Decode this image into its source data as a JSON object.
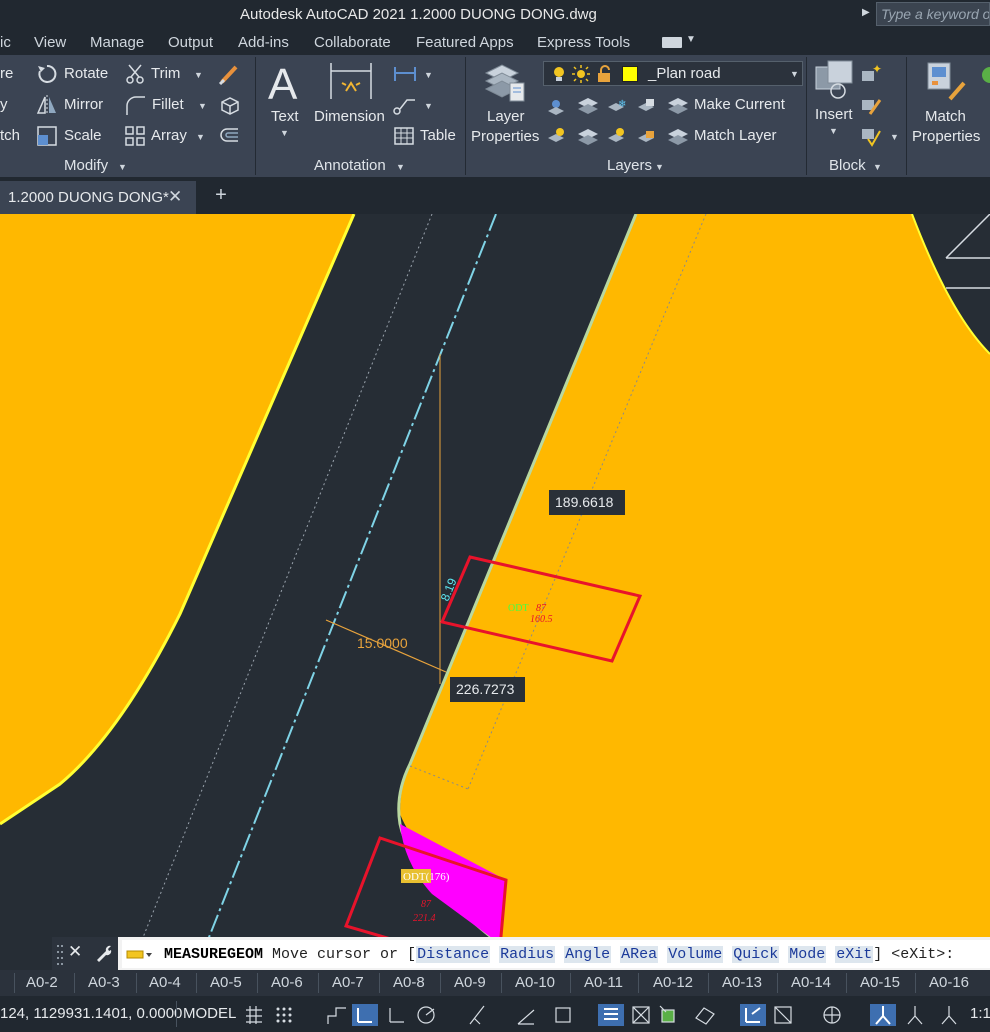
{
  "window": {
    "title": "Autodesk AutoCAD 2021    1.2000 DUONG DONG.dwg",
    "search_placeholder": "Type a keyword or"
  },
  "menu": {
    "tabs": [
      "ic",
      "View",
      "Manage",
      "Output",
      "Add-ins",
      "Collaborate",
      "Featured Apps",
      "Express Tools"
    ]
  },
  "ribbon": {
    "modify": {
      "title": "Modify",
      "left_cut_labels": [
        "re",
        "y",
        "tch"
      ],
      "rotate": "Rotate",
      "mirror": "Mirror",
      "scale": "Scale",
      "trim": "Trim",
      "fillet": "Fillet",
      "array": "Array"
    },
    "annotation": {
      "title": "Annotation",
      "text": "Text",
      "dimension": "Dimension",
      "table": "Table"
    },
    "layers": {
      "title": "Layers",
      "current_layer": "_Plan road",
      "current_layer_color": "#ffff00",
      "layer_properties_line1": "Layer",
      "layer_properties_line2": "Properties",
      "make_current": "Make Current",
      "match_layer": "Match Layer"
    },
    "block": {
      "title": "Block",
      "insert": "Insert"
    },
    "properties": {
      "match_line1": "Match",
      "match_line2": "Properties"
    }
  },
  "document_tab": {
    "label": "1.2000 DUONG DONG*"
  },
  "drawing": {
    "dim_distance_top": "189.6618",
    "dim_offset": "15.0000",
    "dim_distance_bottom": "226.7273",
    "dim_small": "8.19",
    "parcel_label_1": "ODT",
    "parcel_label_2": "87",
    "parcel_label_3": "160.5",
    "parcel_label_bottom": "ODT(176)",
    "parcel_label_bottom_2": "87",
    "parcel_label_bottom_3": "221.4",
    "colors": {
      "land": "#ffb800",
      "road": "#262d35",
      "parcel_outline": "#e8132b",
      "highlight_parcel": "#ff00ff",
      "dimension": "#e8a33c"
    }
  },
  "command_line": {
    "command": "MEASUREGEOM",
    "prompt_text": " Move cursor or [",
    "options": [
      "Distance",
      "Radius",
      "Angle",
      "ARea",
      "Volume",
      "Quick",
      "Mode",
      "eXit"
    ],
    "suffix": "] <eXit>:"
  },
  "layout_tabs": [
    "A0-2",
    "A0-3",
    "A0-4",
    "A0-5",
    "A0-6",
    "A0-7",
    "A0-8",
    "A0-9",
    "A0-10",
    "A0-11",
    "A0-12",
    "A0-13",
    "A0-14",
    "A0-15",
    "A0-16"
  ],
  "status": {
    "coordinates": "124, 1129931.1401, 0.0000",
    "model": "MODEL",
    "scale": "1:1"
  }
}
